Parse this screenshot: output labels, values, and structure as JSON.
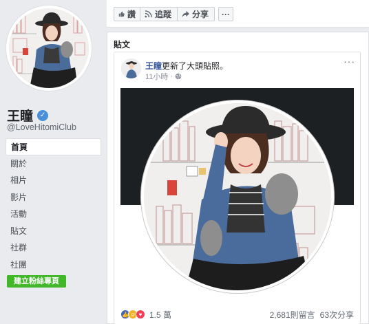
{
  "page": {
    "name": "王瞳",
    "username": "@LoveHitomiClub",
    "nav": [
      "首頁",
      "關於",
      "相片",
      "影片",
      "活動",
      "貼文",
      "社群",
      "社團"
    ],
    "create_page_label": "建立粉絲專頁"
  },
  "actionbar": {
    "like_label": "讚",
    "follow_label": "追蹤",
    "share_label": "分享",
    "more_label": "···"
  },
  "posts": {
    "title": "貼文",
    "post": {
      "author": "王瞳",
      "action": "更新了大頭貼照。",
      "time": "11小時",
      "menu_label": "···",
      "reactions_count": "1.5 萬",
      "comments": "2,681則留言",
      "shares": "63次分享"
    }
  },
  "colors": {
    "link": "#385898",
    "green_button": "#42b72a",
    "verified": "#4a90d9"
  }
}
